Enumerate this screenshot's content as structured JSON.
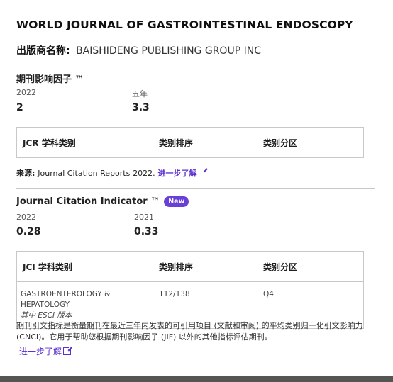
{
  "journal": {
    "title": "WORLD JOURNAL OF GASTROINTESTINAL ENDOSCOPY"
  },
  "publisher": {
    "label": "出版商名称:",
    "name": "BAISHIDENG PUBLISHING GROUP INC"
  },
  "impact_factor": {
    "title": "期刊影响因子 ™",
    "col1_label": "2022",
    "col1_value": "2",
    "col2_label": "五年",
    "col2_value": "3.3",
    "table": {
      "headers": [
        "JCR 学科类别",
        "类别排序",
        "类别分区"
      ]
    },
    "source_label": "来源:",
    "source_text": "Journal Citation Reports",
    "source_year": "2022.",
    "learn_more": "进一步了解"
  },
  "jci": {
    "title": "Journal Citation Indicator ™",
    "badge": "New",
    "col1_label": "2022",
    "col1_value": "0.28",
    "col2_label": "2021",
    "col2_value": "0.33",
    "table": {
      "headers": [
        "JCI 学科类别",
        "类别排序",
        "类别分区"
      ],
      "rows": [
        {
          "category": "GASTROENTEROLOGY & HEPATOLOGY",
          "edition": "其中 ESCI 版本",
          "rank": "112/138",
          "quartile": "Q4"
        }
      ]
    },
    "description": "期刊引文指标是衡量期刊在最近三年内发表的可引用项目 (文献和审阅) 的平均类别归一化引文影响力 (CNCI)。它用于帮助您根据期刊影响因子 (JIF) 以外的其他指标评估期刊。",
    "learn_more": "进一步了解"
  },
  "colors": {
    "accent": "#5b2fcf",
    "badge": "#6a3fd6",
    "border": "#c8c8c8"
  },
  "icons": {
    "external_link": "external-link-icon"
  }
}
